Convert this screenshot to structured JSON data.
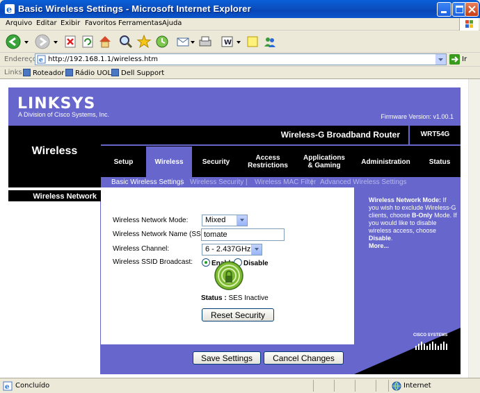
{
  "window": {
    "title": "Basic Wireless Settings - Microsoft Internet Explorer"
  },
  "menu": [
    "Arquivo",
    "Editar",
    "Exibir",
    "Favoritos",
    "Ferramentas",
    "Ajuda"
  ],
  "address": {
    "label": "Endereço",
    "url": "http://192.168.1.1/wireless.htm",
    "go_label": "Ir"
  },
  "links": {
    "label": "Links",
    "items": [
      "Roteador",
      "Rádio UOL",
      "Dell Support"
    ]
  },
  "router": {
    "brand": "LINKSYS",
    "brand_sub": "A Division of Cisco Systems, Inc.",
    "firmware": "Firmware Version: v1.00.1",
    "product_name": "Wireless-G Broadband Router",
    "model": "WRT54G",
    "section": "Wireless",
    "tabs": [
      "Setup",
      "Wireless",
      "Security",
      "Access Restrictions",
      "Applications & Gaming",
      "Administration",
      "Status"
    ],
    "subtabs": [
      "Basic Wireless Settings",
      "Wireless Security",
      "Wireless MAC Filter",
      "Advanced Wireless Settings"
    ],
    "left_label": "Wireless Network",
    "form": {
      "mode_label": "Wireless Network Mode:",
      "mode_value": "Mixed",
      "ssid_label": "Wireless Network Name (SSID):",
      "ssid_value": "tomate",
      "channel_label": "Wireless Channel:",
      "channel_value": "6 - 2.437GHz",
      "broadcast_label": "Wireless SSID Broadcast:",
      "enable_label": "Enable",
      "disable_label": "Disable",
      "status_label": "Status :",
      "status_value": "SES Inactive",
      "reset_label": "Reset Security"
    },
    "help": {
      "heading": "Wireless Network Mode:",
      "text1": " If you wish to exclude Wireless-G clients, choose ",
      "bonly": "B-Only",
      "text2": " Mode. If you would like to disable wireless access, choose ",
      "disable": "Disable",
      "text3": ".",
      "more": "More..."
    },
    "cisco": "CISCO SYSTEMS",
    "save_label": "Save Settings",
    "cancel_label": "Cancel Changes"
  },
  "statusbar": {
    "left": "Concluído",
    "right": "Internet"
  },
  "colors": {
    "accent": "#6666cc",
    "titlebar": "#0b55cc"
  }
}
